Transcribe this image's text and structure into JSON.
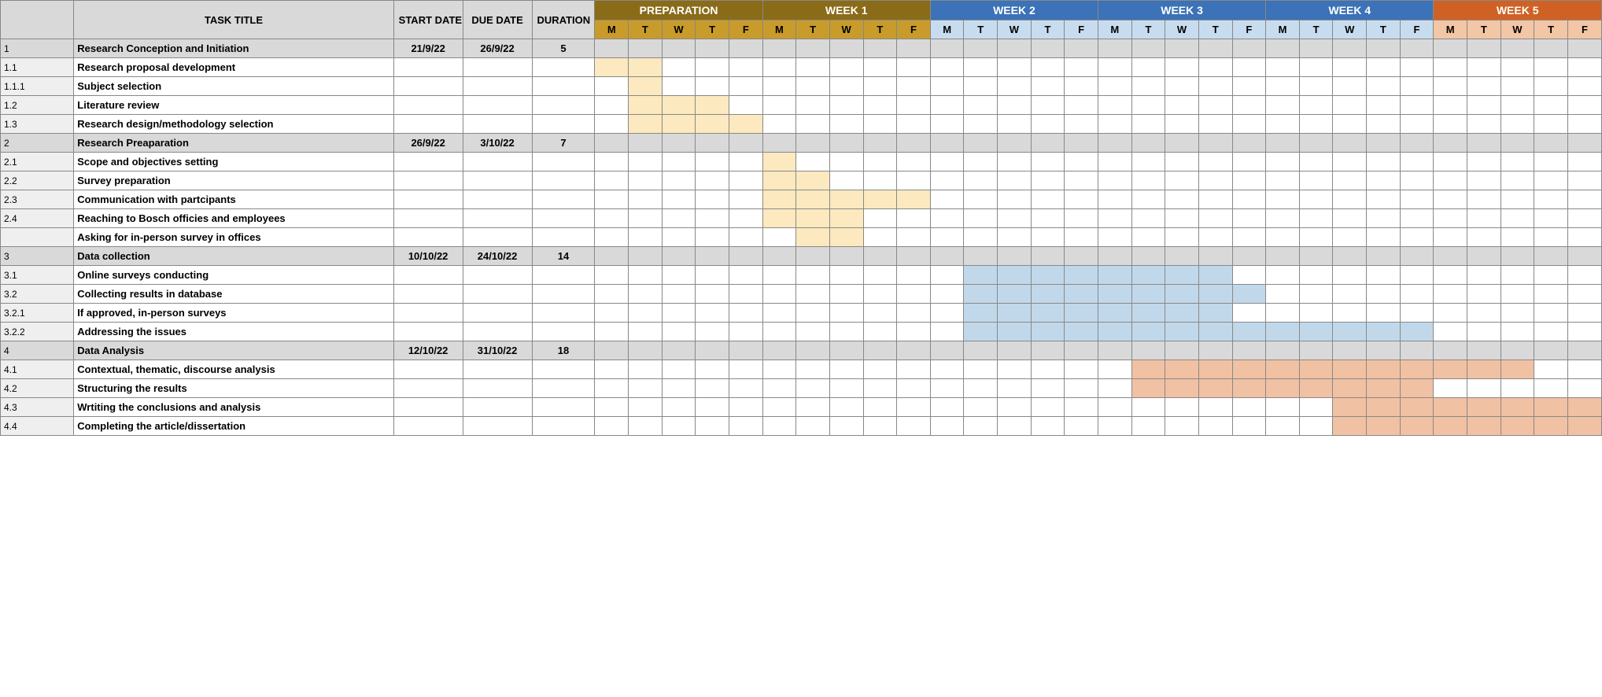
{
  "headers": {
    "task_title": "TASK TITLE",
    "start_date": "START DATE",
    "due_date": "DUE DATE",
    "duration": "DURATION"
  },
  "week_bands": [
    {
      "label": "PREPARATION",
      "class": "band-brown",
      "sub": "sub-brown"
    },
    {
      "label": "WEEK 1",
      "class": "band-brown",
      "sub": "sub-brown"
    },
    {
      "label": "WEEK 2",
      "class": "band-blue",
      "sub": "sub-blue"
    },
    {
      "label": "WEEK 3",
      "class": "band-blue",
      "sub": "sub-blue"
    },
    {
      "label": "WEEK 4",
      "class": "band-blue",
      "sub": "sub-blue"
    },
    {
      "label": "WEEK 5",
      "class": "band-orange",
      "sub": "sub-orange"
    }
  ],
  "day_labels": [
    "M",
    "T",
    "W",
    "T",
    "F"
  ],
  "rows": [
    {
      "num": "1",
      "title": "Research Conception and Initiation",
      "start": "21/9/22",
      "due": "26/9/22",
      "dur": "5",
      "section": true,
      "fill": []
    },
    {
      "num": "1.1",
      "title": "Research proposal development",
      "start": "",
      "due": "",
      "dur": "",
      "section": false,
      "fill": [
        {
          "i": 0,
          "c": "fill-cream"
        },
        {
          "i": 1,
          "c": "fill-cream"
        }
      ]
    },
    {
      "num": "1.1.1",
      "title": "Subject selection",
      "start": "",
      "due": "",
      "dur": "",
      "section": false,
      "fill": [
        {
          "i": 1,
          "c": "fill-cream"
        }
      ]
    },
    {
      "num": "1.2",
      "title": "Literature review",
      "start": "",
      "due": "",
      "dur": "",
      "section": false,
      "fill": [
        {
          "i": 1,
          "c": "fill-cream"
        },
        {
          "i": 2,
          "c": "fill-cream"
        },
        {
          "i": 3,
          "c": "fill-cream"
        }
      ]
    },
    {
      "num": "1.3",
      "title": "Research design/methodology selection",
      "start": "",
      "due": "",
      "dur": "",
      "section": false,
      "fill": [
        {
          "i": 1,
          "c": "fill-cream"
        },
        {
          "i": 2,
          "c": "fill-cream"
        },
        {
          "i": 3,
          "c": "fill-cream"
        },
        {
          "i": 4,
          "c": "fill-cream"
        }
      ]
    },
    {
      "num": "2",
      "title": "Research Preaparation",
      "start": "26/9/22",
      "due": "3/10/22",
      "dur": "7",
      "section": true,
      "fill": []
    },
    {
      "num": "2.1",
      "title": "Scope and objectives setting",
      "start": "",
      "due": "",
      "dur": "",
      "section": false,
      "fill": [
        {
          "i": 5,
          "c": "fill-cream"
        }
      ]
    },
    {
      "num": "2.2",
      "title": "Survey preparation",
      "start": "",
      "due": "",
      "dur": "",
      "section": false,
      "fill": [
        {
          "i": 5,
          "c": "fill-cream"
        },
        {
          "i": 6,
          "c": "fill-cream"
        }
      ]
    },
    {
      "num": "2.3",
      "title": "Communication with partcipants",
      "start": "",
      "due": "",
      "dur": "",
      "section": false,
      "fill": [
        {
          "i": 5,
          "c": "fill-cream"
        },
        {
          "i": 6,
          "c": "fill-cream"
        },
        {
          "i": 7,
          "c": "fill-cream"
        },
        {
          "i": 8,
          "c": "fill-cream"
        },
        {
          "i": 9,
          "c": "fill-cream"
        }
      ]
    },
    {
      "num": "2.4",
      "title": "Reaching to Bosch officies and employees",
      "start": "",
      "due": "",
      "dur": "",
      "section": false,
      "fill": [
        {
          "i": 5,
          "c": "fill-cream"
        },
        {
          "i": 6,
          "c": "fill-cream"
        },
        {
          "i": 7,
          "c": "fill-cream"
        }
      ]
    },
    {
      "num": "",
      "title": "Asking for in-person survey in offices",
      "start": "",
      "due": "",
      "dur": "",
      "section": false,
      "fill": [
        {
          "i": 6,
          "c": "fill-cream"
        },
        {
          "i": 7,
          "c": "fill-cream"
        }
      ]
    },
    {
      "num": "3",
      "title": "Data collection",
      "start": "10/10/22",
      "due": "24/10/22",
      "dur": "14",
      "section": true,
      "fill": []
    },
    {
      "num": "3.1",
      "title": "Online surveys conducting",
      "start": "",
      "due": "",
      "dur": "",
      "section": false,
      "fill": [
        {
          "i": 11,
          "c": "fill-blue"
        },
        {
          "i": 12,
          "c": "fill-blue"
        },
        {
          "i": 13,
          "c": "fill-blue"
        },
        {
          "i": 14,
          "c": "fill-blue"
        },
        {
          "i": 15,
          "c": "fill-blue"
        },
        {
          "i": 16,
          "c": "fill-blue"
        },
        {
          "i": 17,
          "c": "fill-blue"
        },
        {
          "i": 18,
          "c": "fill-blue"
        }
      ]
    },
    {
      "num": "3.2",
      "title": "Collecting results in database",
      "start": "",
      "due": "",
      "dur": "",
      "section": false,
      "fill": [
        {
          "i": 11,
          "c": "fill-blue"
        },
        {
          "i": 12,
          "c": "fill-blue"
        },
        {
          "i": 13,
          "c": "fill-blue"
        },
        {
          "i": 14,
          "c": "fill-blue"
        },
        {
          "i": 15,
          "c": "fill-blue"
        },
        {
          "i": 16,
          "c": "fill-blue"
        },
        {
          "i": 17,
          "c": "fill-blue"
        },
        {
          "i": 18,
          "c": "fill-blue"
        },
        {
          "i": 19,
          "c": "fill-blue"
        }
      ]
    },
    {
      "num": "3.2.1",
      "title": "If approved, in-person surveys",
      "start": "",
      "due": "",
      "dur": "",
      "section": false,
      "fill": [
        {
          "i": 11,
          "c": "fill-blue"
        },
        {
          "i": 12,
          "c": "fill-blue"
        },
        {
          "i": 13,
          "c": "fill-blue"
        },
        {
          "i": 14,
          "c": "fill-blue"
        },
        {
          "i": 15,
          "c": "fill-blue"
        },
        {
          "i": 16,
          "c": "fill-blue"
        },
        {
          "i": 17,
          "c": "fill-blue"
        },
        {
          "i": 18,
          "c": "fill-blue"
        }
      ]
    },
    {
      "num": "3.2.2",
      "title": "Addressing the issues",
      "start": "",
      "due": "",
      "dur": "",
      "section": false,
      "fill": [
        {
          "i": 11,
          "c": "fill-blue"
        },
        {
          "i": 12,
          "c": "fill-blue"
        },
        {
          "i": 13,
          "c": "fill-blue"
        },
        {
          "i": 14,
          "c": "fill-blue"
        },
        {
          "i": 15,
          "c": "fill-blue"
        },
        {
          "i": 16,
          "c": "fill-blue"
        },
        {
          "i": 17,
          "c": "fill-blue"
        },
        {
          "i": 18,
          "c": "fill-blue"
        },
        {
          "i": 19,
          "c": "fill-blue"
        },
        {
          "i": 20,
          "c": "fill-blue"
        },
        {
          "i": 21,
          "c": "fill-blue"
        },
        {
          "i": 22,
          "c": "fill-blue"
        },
        {
          "i": 23,
          "c": "fill-blue"
        },
        {
          "i": 24,
          "c": "fill-blue"
        }
      ]
    },
    {
      "num": "4",
      "title": "Data Analysis",
      "start": "12/10/22",
      "due": "31/10/22",
      "dur": "18",
      "section": true,
      "fill": []
    },
    {
      "num": "4.1",
      "title": "Contextual, thematic, discourse analysis",
      "start": "",
      "due": "",
      "dur": "",
      "section": false,
      "fill": [
        {
          "i": 16,
          "c": "fill-orange"
        },
        {
          "i": 17,
          "c": "fill-orange"
        },
        {
          "i": 18,
          "c": "fill-orange"
        },
        {
          "i": 19,
          "c": "fill-orange"
        },
        {
          "i": 20,
          "c": "fill-orange"
        },
        {
          "i": 21,
          "c": "fill-orange"
        },
        {
          "i": 22,
          "c": "fill-orange"
        },
        {
          "i": 23,
          "c": "fill-orange"
        },
        {
          "i": 24,
          "c": "fill-orange"
        },
        {
          "i": 25,
          "c": "fill-orange"
        },
        {
          "i": 26,
          "c": "fill-orange"
        },
        {
          "i": 27,
          "c": "fill-orange"
        }
      ]
    },
    {
      "num": "4.2",
      "title": "Structuring the results",
      "start": "",
      "due": "",
      "dur": "",
      "section": false,
      "fill": [
        {
          "i": 16,
          "c": "fill-orange"
        },
        {
          "i": 17,
          "c": "fill-orange"
        },
        {
          "i": 18,
          "c": "fill-orange"
        },
        {
          "i": 19,
          "c": "fill-orange"
        },
        {
          "i": 20,
          "c": "fill-orange"
        },
        {
          "i": 21,
          "c": "fill-orange"
        },
        {
          "i": 22,
          "c": "fill-orange"
        },
        {
          "i": 23,
          "c": "fill-orange"
        },
        {
          "i": 24,
          "c": "fill-orange"
        }
      ]
    },
    {
      "num": "4.3",
      "title": "Wrtiting the conclusions and analysis",
      "start": "",
      "due": "",
      "dur": "",
      "section": false,
      "fill": [
        {
          "i": 22,
          "c": "fill-orange"
        },
        {
          "i": 23,
          "c": "fill-orange"
        },
        {
          "i": 24,
          "c": "fill-orange"
        },
        {
          "i": 25,
          "c": "fill-orange"
        },
        {
          "i": 26,
          "c": "fill-orange"
        },
        {
          "i": 27,
          "c": "fill-orange"
        },
        {
          "i": 28,
          "c": "fill-orange"
        },
        {
          "i": 29,
          "c": "fill-orange"
        }
      ]
    },
    {
      "num": "4.4",
      "title": "Completing the article/dissertation",
      "start": "",
      "due": "",
      "dur": "",
      "section": false,
      "fill": [
        {
          "i": 22,
          "c": "fill-orange"
        },
        {
          "i": 23,
          "c": "fill-orange"
        },
        {
          "i": 24,
          "c": "fill-orange"
        },
        {
          "i": 25,
          "c": "fill-orange"
        },
        {
          "i": 26,
          "c": "fill-orange"
        },
        {
          "i": 27,
          "c": "fill-orange"
        },
        {
          "i": 28,
          "c": "fill-orange"
        },
        {
          "i": 29,
          "c": "fill-orange"
        }
      ]
    }
  ]
}
